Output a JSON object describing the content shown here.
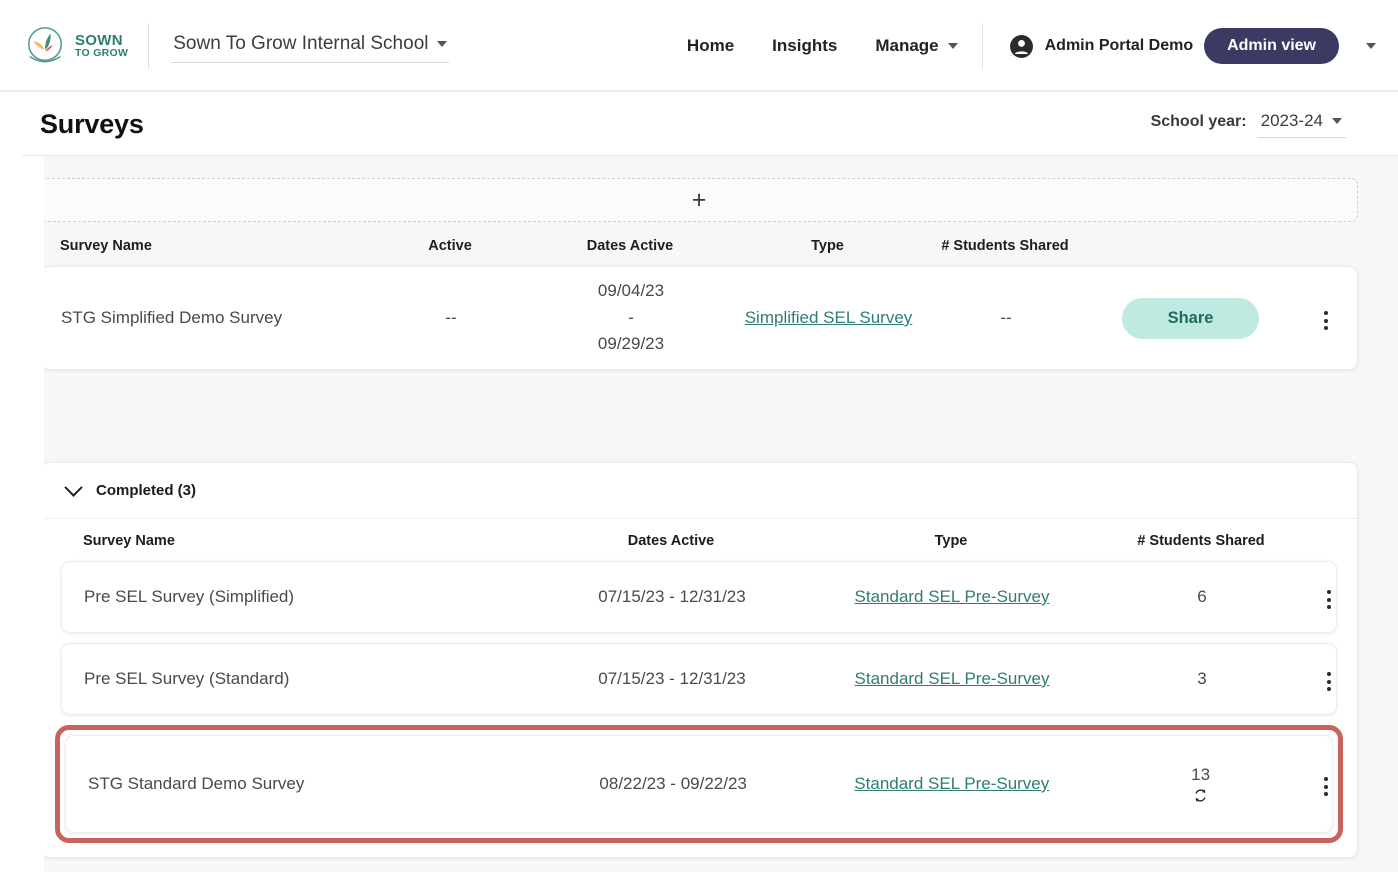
{
  "brand": {
    "logo_line1": "SOWN",
    "logo_line2": "TO GROW",
    "teal": "#2e7d72",
    "navy": "#3a3a63",
    "mint": "#bfeae2",
    "highlight_red": "#c8635c"
  },
  "topnav": {
    "school_selector": "Sown To Grow Internal School",
    "links": [
      {
        "label": "Home",
        "has_caret": false
      },
      {
        "label": "Insights",
        "has_caret": false
      },
      {
        "label": "Manage",
        "has_caret": true
      }
    ],
    "user_name": "Admin Portal Demo",
    "admin_view_label": "Admin view"
  },
  "header": {
    "title": "Surveys",
    "school_year_label": "School year:",
    "school_year_value": "2023-24"
  },
  "main": {
    "add_button_icon": "+",
    "active_table": {
      "columns": [
        "Survey Name",
        "Active",
        "Dates Active",
        "Type",
        "# Students Shared"
      ],
      "rows": [
        {
          "name": "STG Simplified Demo Survey",
          "active": "--",
          "date_start": "09/04/23",
          "date_sep": "-",
          "date_end": "09/29/23",
          "type": "Simplified SEL Survey",
          "students_shared": "--",
          "action_label": "Share"
        }
      ]
    },
    "completed_section": {
      "title": "Completed (3)",
      "columns": [
        "Survey Name",
        "Dates Active",
        "Type",
        "# Students Shared"
      ],
      "rows": [
        {
          "name": "Pre SEL Survey (Simplified)",
          "dates": "07/15/23 - 12/31/23",
          "type": "Standard SEL Pre-Survey",
          "students_shared": "6",
          "has_refresh": false,
          "highlighted": false
        },
        {
          "name": "Pre SEL Survey (Standard)",
          "dates": "07/15/23 - 12/31/23",
          "type": "Standard SEL Pre-Survey",
          "students_shared": "3",
          "has_refresh": false,
          "highlighted": false
        },
        {
          "name": "STG Standard Demo Survey",
          "dates": "08/22/23 - 09/22/23",
          "type": "Standard SEL Pre-Survey",
          "students_shared": "13",
          "has_refresh": true,
          "highlighted": true
        }
      ]
    }
  }
}
